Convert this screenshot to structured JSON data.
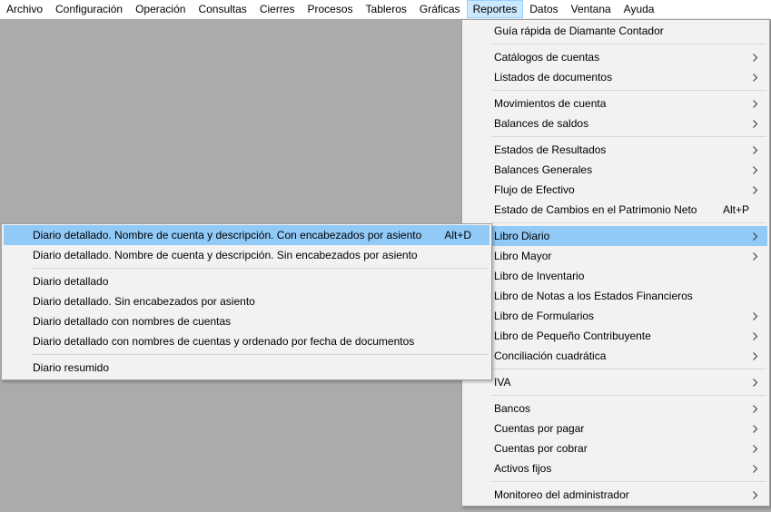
{
  "menubar": {
    "items": [
      "Archivo",
      "Configuración",
      "Operación",
      "Consultas",
      "Cierres",
      "Procesos",
      "Tableros",
      "Gráficas",
      "Reportes",
      "Datos",
      "Ventana",
      "Ayuda"
    ]
  },
  "reportes_menu": {
    "guia": "Guía rápida de Diamante Contador",
    "catalogos": "Catálogos de cuentas",
    "listados": "Listados de documentos",
    "movimientos": "Movimientos de cuenta",
    "balances_saldos": "Balances de saldos",
    "estados_resultados": "Estados de Resultados",
    "balances_generales": "Balances Generales",
    "flujo": "Flujo de Efectivo",
    "estado_cambios": "Estado de Cambios en el Patrimonio Neto",
    "estado_cambios_shortcut": "Alt+P",
    "libro_diario": "Libro Diario",
    "libro_mayor": "Libro Mayor",
    "libro_inventario": "Libro de Inventario",
    "libro_notas": "Libro de Notas a los Estados Financieros",
    "libro_formularios": "Libro de Formularios",
    "libro_pequeno": "Libro de Pequeño Contribuyente",
    "conciliacion": "Conciliación cuadrática",
    "iva": "IVA",
    "bancos": "Bancos",
    "cuentas_pagar": "Cuentas por pagar",
    "cuentas_cobrar": "Cuentas por cobrar",
    "activos": "Activos fijos",
    "monitoreo": "Monitoreo del administrador"
  },
  "libro_diario_menu": {
    "item1": "Diario detallado. Nombre de cuenta y descripción. Con encabezados por asiento",
    "item1_shortcut": "Alt+D",
    "item2": "Diario detallado. Nombre de cuenta y descripción. Sin encabezados por asiento",
    "item3": "Diario detallado",
    "item4": "Diario detallado. Sin encabezados por asiento",
    "item5": "Diario detallado con nombres de cuentas",
    "item6": "Diario detallado con nombres de cuentas y ordenado por fecha de documentos",
    "item7": "Diario resumido"
  },
  "colors": {
    "background": "#ababab",
    "highlight": "#91c9f7",
    "menubar_active": "#cce8ff",
    "menu_bg": "#f2f2f2"
  },
  "icons": {
    "submenu_arrow": "chevron-right-icon"
  }
}
